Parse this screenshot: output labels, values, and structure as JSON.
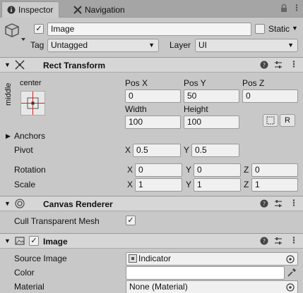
{
  "tabs": [
    {
      "label": "Inspector",
      "icon": "info-icon",
      "active": true
    },
    {
      "label": "Navigation",
      "icon": "navigation-icon",
      "active": false
    }
  ],
  "object": {
    "active": true,
    "name": "Image",
    "static_label": "Static",
    "tag_label": "Tag",
    "tag_value": "Untagged",
    "layer_label": "Layer",
    "layer_value": "UI"
  },
  "rect_transform": {
    "title": "Rect Transform",
    "anchor_h": "center",
    "anchor_v": "middle",
    "pos_x_label": "Pos X",
    "pos_x": "0",
    "pos_y_label": "Pos Y",
    "pos_y": "50",
    "pos_z_label": "Pos Z",
    "pos_z": "0",
    "width_label": "Width",
    "width": "100",
    "height_label": "Height",
    "height": "100",
    "raw_button": "R",
    "anchors_label": "Anchors",
    "pivot_label": "Pivot",
    "pivot_x": "0.5",
    "pivot_y": "0.5",
    "rotation_label": "Rotation",
    "rot_x": "0",
    "rot_y": "0",
    "rot_z": "0",
    "scale_label": "Scale",
    "scale_x": "1",
    "scale_y": "1",
    "scale_z": "1",
    "x": "X",
    "y": "Y",
    "z": "Z"
  },
  "canvas_renderer": {
    "title": "Canvas Renderer",
    "cull_label": "Cull Transparent Mesh",
    "cull_checked": true
  },
  "image": {
    "title": "Image",
    "enabled": true,
    "source_label": "Source Image",
    "source_value": "Indicator",
    "color_label": "Color",
    "material_label": "Material",
    "material_value": "None (Material)"
  },
  "colors": {
    "panel": "#c8c8c8",
    "accent_red": "#d32020",
    "header": "#d6d6d6"
  }
}
